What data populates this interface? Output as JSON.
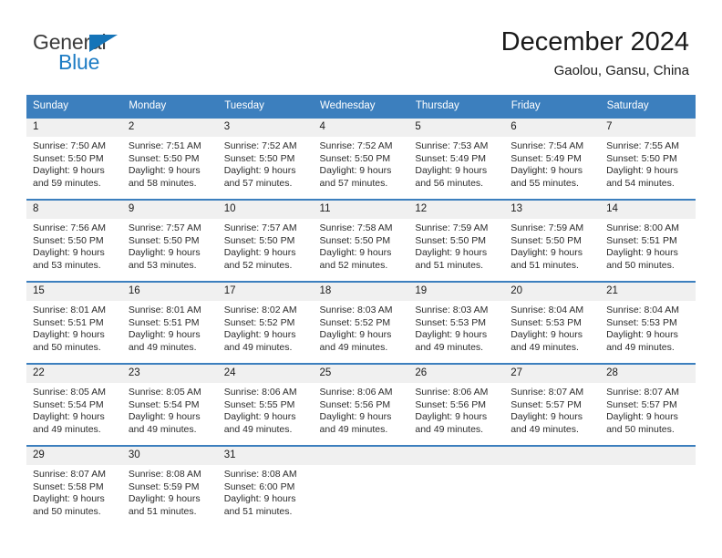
{
  "brand": {
    "name_top": "General",
    "name_bottom": "Blue",
    "color_blue": "#1d7cc4",
    "color_dark": "#3b3b3b"
  },
  "header": {
    "title": "December 2024",
    "subtitle": "Gaolou, Gansu, China"
  },
  "theme": {
    "header_blue": "#3c7fbe",
    "daynum_bg": "#f0f0f0",
    "text": "#2b2b2b"
  },
  "weekdays": [
    "Sunday",
    "Monday",
    "Tuesday",
    "Wednesday",
    "Thursday",
    "Friday",
    "Saturday"
  ],
  "weeks": [
    [
      {
        "day": "1",
        "sunrise": "Sunrise: 7:50 AM",
        "sunset": "Sunset: 5:50 PM",
        "daylight1": "Daylight: 9 hours",
        "daylight2": "and 59 minutes."
      },
      {
        "day": "2",
        "sunrise": "Sunrise: 7:51 AM",
        "sunset": "Sunset: 5:50 PM",
        "daylight1": "Daylight: 9 hours",
        "daylight2": "and 58 minutes."
      },
      {
        "day": "3",
        "sunrise": "Sunrise: 7:52 AM",
        "sunset": "Sunset: 5:50 PM",
        "daylight1": "Daylight: 9 hours",
        "daylight2": "and 57 minutes."
      },
      {
        "day": "4",
        "sunrise": "Sunrise: 7:52 AM",
        "sunset": "Sunset: 5:50 PM",
        "daylight1": "Daylight: 9 hours",
        "daylight2": "and 57 minutes."
      },
      {
        "day": "5",
        "sunrise": "Sunrise: 7:53 AM",
        "sunset": "Sunset: 5:49 PM",
        "daylight1": "Daylight: 9 hours",
        "daylight2": "and 56 minutes."
      },
      {
        "day": "6",
        "sunrise": "Sunrise: 7:54 AM",
        "sunset": "Sunset: 5:49 PM",
        "daylight1": "Daylight: 9 hours",
        "daylight2": "and 55 minutes."
      },
      {
        "day": "7",
        "sunrise": "Sunrise: 7:55 AM",
        "sunset": "Sunset: 5:50 PM",
        "daylight1": "Daylight: 9 hours",
        "daylight2": "and 54 minutes."
      }
    ],
    [
      {
        "day": "8",
        "sunrise": "Sunrise: 7:56 AM",
        "sunset": "Sunset: 5:50 PM",
        "daylight1": "Daylight: 9 hours",
        "daylight2": "and 53 minutes."
      },
      {
        "day": "9",
        "sunrise": "Sunrise: 7:57 AM",
        "sunset": "Sunset: 5:50 PM",
        "daylight1": "Daylight: 9 hours",
        "daylight2": "and 53 minutes."
      },
      {
        "day": "10",
        "sunrise": "Sunrise: 7:57 AM",
        "sunset": "Sunset: 5:50 PM",
        "daylight1": "Daylight: 9 hours",
        "daylight2": "and 52 minutes."
      },
      {
        "day": "11",
        "sunrise": "Sunrise: 7:58 AM",
        "sunset": "Sunset: 5:50 PM",
        "daylight1": "Daylight: 9 hours",
        "daylight2": "and 52 minutes."
      },
      {
        "day": "12",
        "sunrise": "Sunrise: 7:59 AM",
        "sunset": "Sunset: 5:50 PM",
        "daylight1": "Daylight: 9 hours",
        "daylight2": "and 51 minutes."
      },
      {
        "day": "13",
        "sunrise": "Sunrise: 7:59 AM",
        "sunset": "Sunset: 5:50 PM",
        "daylight1": "Daylight: 9 hours",
        "daylight2": "and 51 minutes."
      },
      {
        "day": "14",
        "sunrise": "Sunrise: 8:00 AM",
        "sunset": "Sunset: 5:51 PM",
        "daylight1": "Daylight: 9 hours",
        "daylight2": "and 50 minutes."
      }
    ],
    [
      {
        "day": "15",
        "sunrise": "Sunrise: 8:01 AM",
        "sunset": "Sunset: 5:51 PM",
        "daylight1": "Daylight: 9 hours",
        "daylight2": "and 50 minutes."
      },
      {
        "day": "16",
        "sunrise": "Sunrise: 8:01 AM",
        "sunset": "Sunset: 5:51 PM",
        "daylight1": "Daylight: 9 hours",
        "daylight2": "and 49 minutes."
      },
      {
        "day": "17",
        "sunrise": "Sunrise: 8:02 AM",
        "sunset": "Sunset: 5:52 PM",
        "daylight1": "Daylight: 9 hours",
        "daylight2": "and 49 minutes."
      },
      {
        "day": "18",
        "sunrise": "Sunrise: 8:03 AM",
        "sunset": "Sunset: 5:52 PM",
        "daylight1": "Daylight: 9 hours",
        "daylight2": "and 49 minutes."
      },
      {
        "day": "19",
        "sunrise": "Sunrise: 8:03 AM",
        "sunset": "Sunset: 5:53 PM",
        "daylight1": "Daylight: 9 hours",
        "daylight2": "and 49 minutes."
      },
      {
        "day": "20",
        "sunrise": "Sunrise: 8:04 AM",
        "sunset": "Sunset: 5:53 PM",
        "daylight1": "Daylight: 9 hours",
        "daylight2": "and 49 minutes."
      },
      {
        "day": "21",
        "sunrise": "Sunrise: 8:04 AM",
        "sunset": "Sunset: 5:53 PM",
        "daylight1": "Daylight: 9 hours",
        "daylight2": "and 49 minutes."
      }
    ],
    [
      {
        "day": "22",
        "sunrise": "Sunrise: 8:05 AM",
        "sunset": "Sunset: 5:54 PM",
        "daylight1": "Daylight: 9 hours",
        "daylight2": "and 49 minutes."
      },
      {
        "day": "23",
        "sunrise": "Sunrise: 8:05 AM",
        "sunset": "Sunset: 5:54 PM",
        "daylight1": "Daylight: 9 hours",
        "daylight2": "and 49 minutes."
      },
      {
        "day": "24",
        "sunrise": "Sunrise: 8:06 AM",
        "sunset": "Sunset: 5:55 PM",
        "daylight1": "Daylight: 9 hours",
        "daylight2": "and 49 minutes."
      },
      {
        "day": "25",
        "sunrise": "Sunrise: 8:06 AM",
        "sunset": "Sunset: 5:56 PM",
        "daylight1": "Daylight: 9 hours",
        "daylight2": "and 49 minutes."
      },
      {
        "day": "26",
        "sunrise": "Sunrise: 8:06 AM",
        "sunset": "Sunset: 5:56 PM",
        "daylight1": "Daylight: 9 hours",
        "daylight2": "and 49 minutes."
      },
      {
        "day": "27",
        "sunrise": "Sunrise: 8:07 AM",
        "sunset": "Sunset: 5:57 PM",
        "daylight1": "Daylight: 9 hours",
        "daylight2": "and 49 minutes."
      },
      {
        "day": "28",
        "sunrise": "Sunrise: 8:07 AM",
        "sunset": "Sunset: 5:57 PM",
        "daylight1": "Daylight: 9 hours",
        "daylight2": "and 50 minutes."
      }
    ],
    [
      {
        "day": "29",
        "sunrise": "Sunrise: 8:07 AM",
        "sunset": "Sunset: 5:58 PM",
        "daylight1": "Daylight: 9 hours",
        "daylight2": "and 50 minutes."
      },
      {
        "day": "30",
        "sunrise": "Sunrise: 8:08 AM",
        "sunset": "Sunset: 5:59 PM",
        "daylight1": "Daylight: 9 hours",
        "daylight2": "and 51 minutes."
      },
      {
        "day": "31",
        "sunrise": "Sunrise: 8:08 AM",
        "sunset": "Sunset: 6:00 PM",
        "daylight1": "Daylight: 9 hours",
        "daylight2": "and 51 minutes."
      },
      null,
      null,
      null,
      null
    ]
  ]
}
